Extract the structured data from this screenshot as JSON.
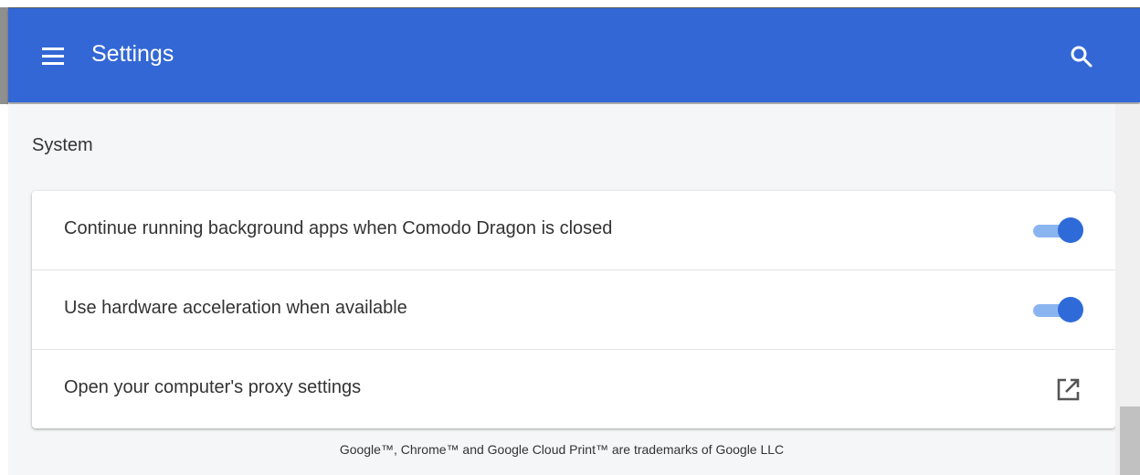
{
  "header": {
    "title": "Settings",
    "background_color": "#3367d6",
    "menu_icon": "hamburger-menu-icon",
    "search_icon": "search-icon"
  },
  "section": {
    "title": "System"
  },
  "settings": [
    {
      "label": "Continue running background apps when Comodo Dragon is closed",
      "control": "toggle",
      "enabled": true
    },
    {
      "label": "Use hardware acceleration when available",
      "control": "toggle",
      "enabled": true
    },
    {
      "label": "Open your computer's proxy settings",
      "control": "external-link",
      "icon": "open-in-new-icon"
    }
  ],
  "footer": {
    "text": "Google™, Chrome™ and Google Cloud Print™ are trademarks of Google LLC"
  },
  "colors": {
    "accent": "#2f6bd8",
    "toggle_track": "#8ab4f0",
    "page_background": "#f5f6f7"
  }
}
